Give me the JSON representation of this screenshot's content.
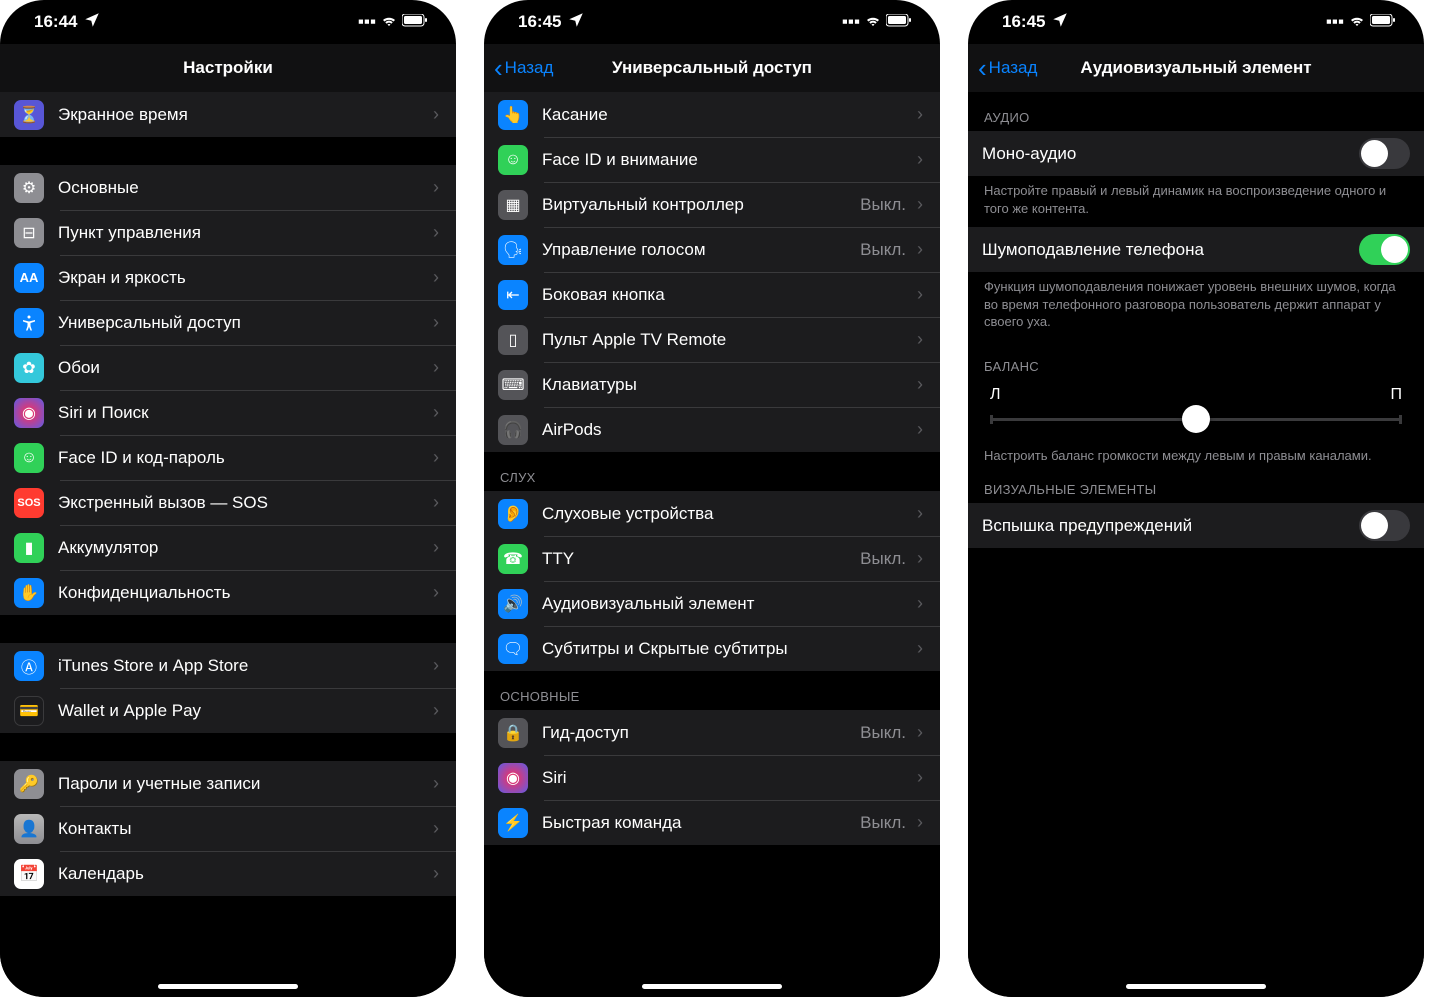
{
  "status": {
    "time1": "16:44",
    "time2": "16:45",
    "time3": "16:45"
  },
  "phone1": {
    "title": "Настройки",
    "rows": [
      {
        "icon": "hourglass-icon",
        "bg": "#5856d6",
        "label": "Экранное время"
      },
      null,
      {
        "icon": "gear-icon",
        "bg": "#8e8e93",
        "label": "Основные"
      },
      {
        "icon": "switches-icon",
        "bg": "#8e8e93",
        "label": "Пункт управления"
      },
      {
        "icon": "aa-icon",
        "bg": "#0a84ff",
        "label": "Экран и яркость"
      },
      {
        "icon": "accessibility-icon",
        "bg": "#0a84ff",
        "label": "Универсальный доступ"
      },
      {
        "icon": "flower-icon",
        "bg": "#34c8db",
        "label": "Обои"
      },
      {
        "icon": "siri-icon",
        "bg": "#1c1c1e",
        "label": "Siri и Поиск"
      },
      {
        "icon": "faceid-icon",
        "bg": "#30d158",
        "label": "Face ID и код-пароль"
      },
      {
        "icon": "sos-icon",
        "bg": "#ff3b30",
        "label": "Экстренный вызов — SOS"
      },
      {
        "icon": "battery-icon",
        "bg": "#30d158",
        "label": "Аккумулятор"
      },
      {
        "icon": "hand-icon",
        "bg": "#0a84ff",
        "label": "Конфиденциальность"
      },
      null,
      {
        "icon": "appstore-icon",
        "bg": "#0a84ff",
        "label": "iTunes Store и App Store"
      },
      {
        "icon": "wallet-icon",
        "bg": "#1c1c1e",
        "label": "Wallet и Apple Pay"
      },
      null,
      {
        "icon": "key-icon",
        "bg": "#8e8e93",
        "label": "Пароли и учетные записи"
      },
      {
        "icon": "contacts-icon",
        "bg": "#8e8e93",
        "label": "Контакты"
      },
      {
        "icon": "calendar-icon",
        "bg": "#fff",
        "label": "Календарь"
      }
    ]
  },
  "phone2": {
    "back": "Назад",
    "title": "Универсальный доступ",
    "sections": {
      "hearing": "СЛУХ",
      "general": "ОСНОВНЫЕ"
    },
    "rows": [
      {
        "icon": "touch-icon",
        "bg": "#0a84ff",
        "label": "Касание"
      },
      {
        "icon": "faceid-icon",
        "bg": "#30d158",
        "label": "Face ID и внимание"
      },
      {
        "icon": "grid-icon",
        "bg": "#545458",
        "label": "Виртуальный контроллер",
        "value": "Выкл."
      },
      {
        "icon": "voice-icon",
        "bg": "#0a84ff",
        "label": "Управление голосом",
        "value": "Выкл."
      },
      {
        "icon": "side-button-icon",
        "bg": "#0a84ff",
        "label": "Боковая кнопка"
      },
      {
        "icon": "remote-icon",
        "bg": "#545458",
        "label": "Пульт Apple TV Remote"
      },
      {
        "icon": "keyboard-icon",
        "bg": "#545458",
        "label": "Клавиатуры"
      },
      {
        "icon": "airpods-icon",
        "bg": "#545458",
        "label": "AirPods"
      },
      {
        "icon": "ear-icon",
        "bg": "#0a84ff",
        "label": "Слуховые устройства"
      },
      {
        "icon": "tty-icon",
        "bg": "#30d158",
        "label": "TTY",
        "value": "Выкл."
      },
      {
        "icon": "audiovisual-icon",
        "bg": "#0a84ff",
        "label": "Аудиовизуальный элемент"
      },
      {
        "icon": "subtitles-icon",
        "bg": "#0a84ff",
        "label": "Субтитры и Скрытые субтитры"
      },
      {
        "icon": "lock-icon",
        "bg": "#545458",
        "label": "Гид-доступ",
        "value": "Выкл."
      },
      {
        "icon": "siri-icon",
        "bg": "#1c1c1e",
        "label": "Siri"
      },
      {
        "icon": "shortcut-icon",
        "bg": "#0a84ff",
        "label": "Быстрая команда",
        "value": "Выкл."
      }
    ]
  },
  "phone3": {
    "back": "Назад",
    "title": "Аудиовизуальный элемент",
    "sections": {
      "audio": "АУДИО",
      "balance": "БАЛАНС",
      "visual": "ВИЗУАЛЬНЫЕ ЭЛЕМЕНТЫ"
    },
    "rows": {
      "mono": "Моно-аудио",
      "mono_footer": "Настройте правый и левый динамик на воспроизведение одного и того же контента.",
      "noise": "Шумоподавление телефона",
      "noise_footer": "Функция шумоподавления понижает уровень внешних шумов, когда во время телефонного разговора пользователь держит аппарат у своего уха.",
      "balance_left": "Л",
      "balance_right": "П",
      "balance_footer": "Настроить баланс громкости между левым и правым каналами.",
      "flash": "Вспышка предупреждений"
    }
  }
}
